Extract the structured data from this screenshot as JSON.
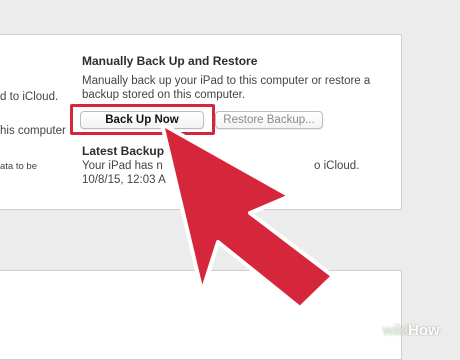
{
  "left_partial": {
    "icloud_text": "d to iCloud.",
    "computer_text": "his computer",
    "tobe_text": "ata to be"
  },
  "manual": {
    "title": "Manually Back Up and Restore",
    "desc_line1": "Manually back up your iPad to this computer or restore a",
    "desc_line2": "backup stored on this computer.",
    "backup_now_label": "Back Up Now",
    "restore_label": "Restore Backup..."
  },
  "latest": {
    "title": "Latest Backup",
    "line1": "Your iPad has n",
    "line1_tail": "o iCloud.",
    "line2": "10/8/15, 12:03 A"
  },
  "watermark": {
    "wiki": "wiki",
    "how": "How"
  },
  "colors": {
    "highlight": "#d6263b",
    "arrow": "#d6263b",
    "arrow_outline": "#ffffff"
  }
}
